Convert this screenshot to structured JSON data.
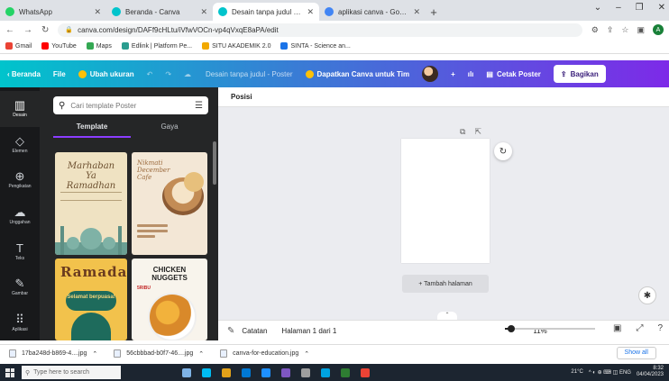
{
  "browser": {
    "tabs": [
      {
        "title": "WhatsApp",
        "favicon_color": "#25d366",
        "active": false
      },
      {
        "title": "Beranda - Canva",
        "favicon_color": "#00c4cc",
        "active": false
      },
      {
        "title": "Desain tanpa judul - Poster",
        "favicon_color": "#00c4cc",
        "active": true
      },
      {
        "title": "aplikasi canva - Google Penelus",
        "favicon_color": "#4285f4",
        "active": false
      }
    ],
    "close_glyph": "✕",
    "newtab_glyph": "+",
    "window_controls": [
      "⌄",
      "–",
      "❐",
      "✕"
    ],
    "url": "canva.com/design/DAFf9cHLtu/iVfwVOCn-vp4qVxqE8aPA/edit",
    "nav_icons": [
      "←",
      "→",
      "↻"
    ],
    "right_icons": [
      "⚙",
      "⇪",
      "☆",
      "▣"
    ],
    "profile_initial": "A",
    "bookmarks": [
      {
        "label": "Gmail",
        "color": "#ea4335"
      },
      {
        "label": "YouTube",
        "color": "#ff0000"
      },
      {
        "label": "Maps",
        "color": "#34a853"
      },
      {
        "label": "Edlink | Platform Pe...",
        "color": "#2a9d8f"
      },
      {
        "label": "SITU AKADEMIK 2.0",
        "color": "#f2a900"
      },
      {
        "label": "SINTA - Science an...",
        "color": "#1a73e8"
      }
    ]
  },
  "canva": {
    "topbar": {
      "home": "Beranda",
      "home_chevron": "‹",
      "file": "File",
      "resize": "Ubah ukuran",
      "undo": "↶",
      "redo": "↷",
      "cloud": "☁",
      "doc_title": "Desain tanpa judul - Poster",
      "pro": "Dapatkan Canva untuk Tim",
      "add": "+",
      "analytics": "ılı",
      "print": "Cetak Poster",
      "share": "Bagikan",
      "print_icon": "▤",
      "share_icon": "⇪"
    },
    "rail": [
      {
        "label": "Desain",
        "icon": "▥",
        "active": true
      },
      {
        "label": "Elemen",
        "icon": "◇",
        "active": false
      },
      {
        "label": "Pengikatan",
        "icon": "⊕",
        "active": false
      },
      {
        "label": "Unggahan",
        "icon": "☁",
        "active": false
      },
      {
        "label": "Teks",
        "icon": "T",
        "active": false
      },
      {
        "label": "Gambar",
        "icon": "✎",
        "active": false
      },
      {
        "label": "Aplikasi",
        "icon": "⠿",
        "active": false
      }
    ],
    "panel": {
      "search_placeholder": "Cari template Poster",
      "search_icon": "⚲",
      "filter_icon": "☰",
      "tabs": [
        "Template",
        "Gaya"
      ],
      "templates": {
        "t1_title": "Marhaban Ya Ramadhan",
        "t2_title": "Nikmati\nDecember\nCafe",
        "t3_letters": "Ramadan",
        "t3_pill": "Selamat berpuasa!",
        "t4_title": "CHICKEN\nNUGGETS",
        "t4_price": "5RIBU"
      }
    },
    "workspace": {
      "position_label": "Posisi",
      "page_icons": [
        "⧉",
        "⇱"
      ],
      "refresh_icon": "↻",
      "add_page": "+ Tambah halaman",
      "magic_icon": "✱",
      "collapse_icon": "⌃"
    },
    "statusbar": {
      "notes_icon": "✎",
      "notes": "Catatan",
      "page_info": "Halaman 1 dari 1",
      "zoom": "11%",
      "zoom_fraction": 0.11,
      "icons": [
        "▣",
        "⤢",
        "?"
      ]
    }
  },
  "downloads": {
    "items": [
      "17ba248d-b869-4....jpg",
      "56cbbbad-b0f7-46....jpg",
      "canva-for-education.jpg"
    ],
    "chevron": "⌃",
    "show_all": "Show all"
  },
  "taskbar": {
    "search_placeholder": "Type here to search",
    "search_icon": "⚲",
    "apps": [
      "#7fb3e6",
      "#00bcf2",
      "#e3a21a",
      "#0078d4",
      "#1e90ff",
      "#7e57c2",
      "#9e9e9e",
      "#00a3e0",
      "#2e7d32",
      "#ea4335"
    ],
    "weather": "21°C",
    "tray_icons": "^ ◐ ⊕ ⌨ ◫ ENG",
    "time": "8:32",
    "date": "04/04/2023"
  }
}
